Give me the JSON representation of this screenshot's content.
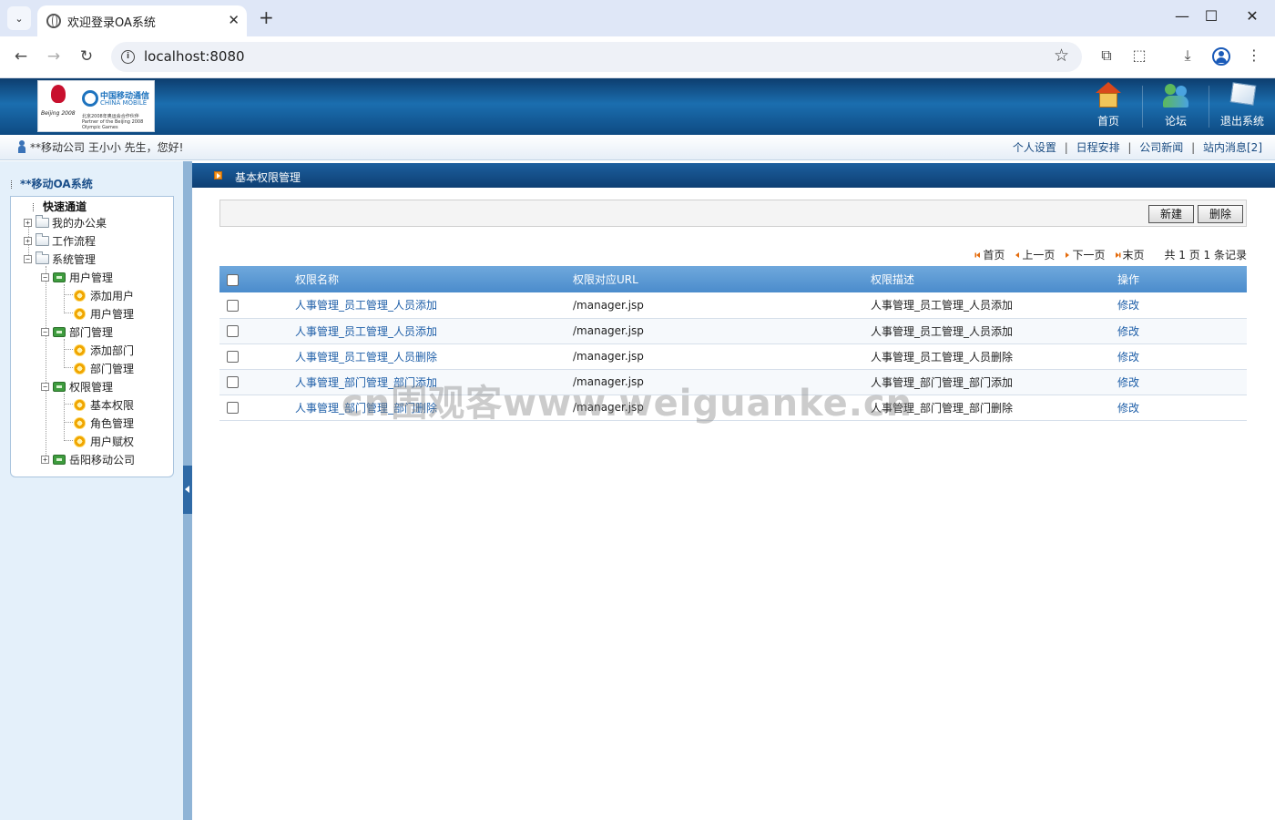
{
  "browser": {
    "tab_title": "欢迎登录OA系统",
    "close_glyph": "✕",
    "new_tab_glyph": "+",
    "url": "localhost:8080",
    "window_controls": [
      "—",
      "☐",
      "✕"
    ]
  },
  "header": {
    "logo": {
      "cn": "中国移动通信",
      "en": "CHINA MOBILE",
      "beijing": "Beijing 2008",
      "partner": "北京2008年奥运会合作伙伴 Partner of the Beijing 2008 Olympic Games"
    },
    "nav": [
      {
        "label": "首页",
        "icon": "home-icon"
      },
      {
        "label": "论坛",
        "icon": "forum-icon"
      },
      {
        "label": "退出系统",
        "icon": "logout-icon"
      }
    ]
  },
  "user_bar": {
    "welcome": "**移动公司 王小小 先生，您好!",
    "links": [
      "个人设置",
      "日程安排",
      "公司新闻",
      "站内消息[2]"
    ],
    "separator": "|"
  },
  "sidebar": {
    "system_title": "**移动OA系统",
    "quick_channel": "快速通道",
    "tree": {
      "my_office": "我的办公桌",
      "workflow": "工作流程",
      "system_mgmt": "系统管理",
      "user_mgmt": "用户管理",
      "add_user": "添加用户",
      "user_mgmt_leaf": "用户管理",
      "dept_mgmt": "部门管理",
      "add_dept": "添加部门",
      "dept_mgmt_leaf": "部门管理",
      "perm_mgmt": "权限管理",
      "basic_perm": "基本权限",
      "role_mgmt": "角色管理",
      "user_grant": "用户赋权",
      "yueyang": "岳阳移动公司"
    },
    "plus": "+",
    "minus": "−"
  },
  "main": {
    "title": "基本权限管理",
    "buttons": {
      "new": "新建",
      "delete": "删除"
    },
    "pager": {
      "first": "首页",
      "prev": "上一页",
      "next": "下一页",
      "last": "末页",
      "summary": "共 1 页 1 条记录"
    },
    "table": {
      "headers": [
        "权限名称",
        "权限对应URL",
        "权限描述",
        "操作"
      ],
      "rows": [
        {
          "name": "人事管理_员工管理_人员添加",
          "url": "/manager.jsp",
          "desc": "人事管理_员工管理_人员添加",
          "op": "修改"
        },
        {
          "name": "人事管理_员工管理_人员添加",
          "url": "/manager.jsp",
          "desc": "人事管理_员工管理_人员添加",
          "op": "修改"
        },
        {
          "name": "人事管理_员工管理_人员删除",
          "url": "/manager.jsp",
          "desc": "人事管理_员工管理_人员删除",
          "op": "修改"
        },
        {
          "name": "人事管理_部门管理_部门添加",
          "url": "/manager.jsp",
          "desc": "人事管理_部门管理_部门添加",
          "op": "修改"
        },
        {
          "name": "人事管理_部门管理_部门删除",
          "url": "/manager.jsp",
          "desc": "人事管理_部门管理_部门删除",
          "op": "修改"
        }
      ]
    }
  },
  "watermark": "cn围观客www.weiguanke.cn",
  "colors": {
    "header_blue": "#1b6eaf",
    "link_blue": "#1f5fa8",
    "table_header": "#5b9bd5",
    "accent_orange": "#f7941d"
  }
}
